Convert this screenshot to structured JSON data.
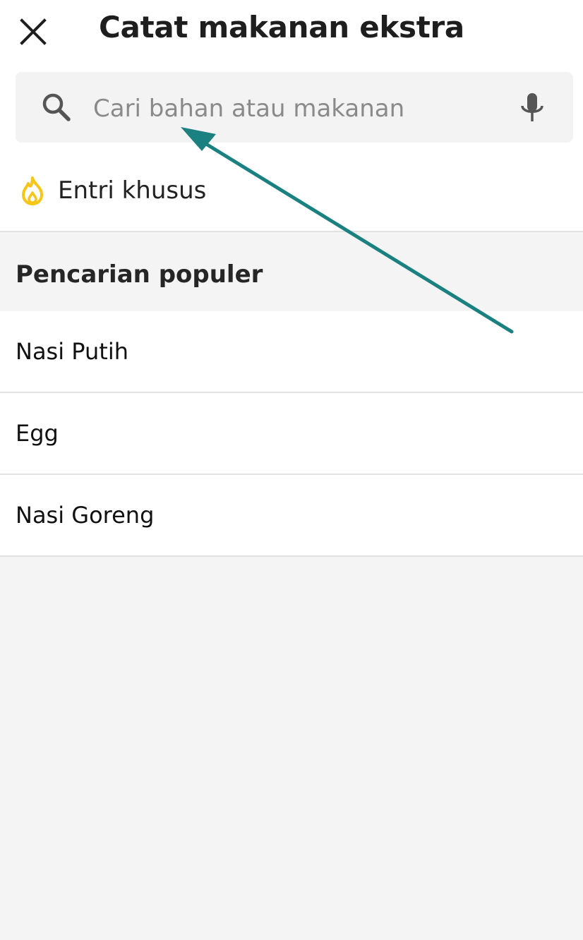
{
  "header": {
    "title": "Catat makanan ekstra",
    "close_icon": "close-icon"
  },
  "search": {
    "placeholder": "Cari bahan atau makanan",
    "search_icon": "search-icon",
    "mic_icon": "microphone-icon"
  },
  "custom_entry": {
    "label": "Entri khusus",
    "icon": "flame-icon",
    "icon_color": "#f5c518"
  },
  "popular": {
    "title": "Pencarian populer",
    "items": [
      {
        "label": "Nasi Putih"
      },
      {
        "label": "Egg"
      },
      {
        "label": "Nasi Goreng"
      }
    ]
  },
  "annotation": {
    "arrow_color": "#1a8080"
  }
}
